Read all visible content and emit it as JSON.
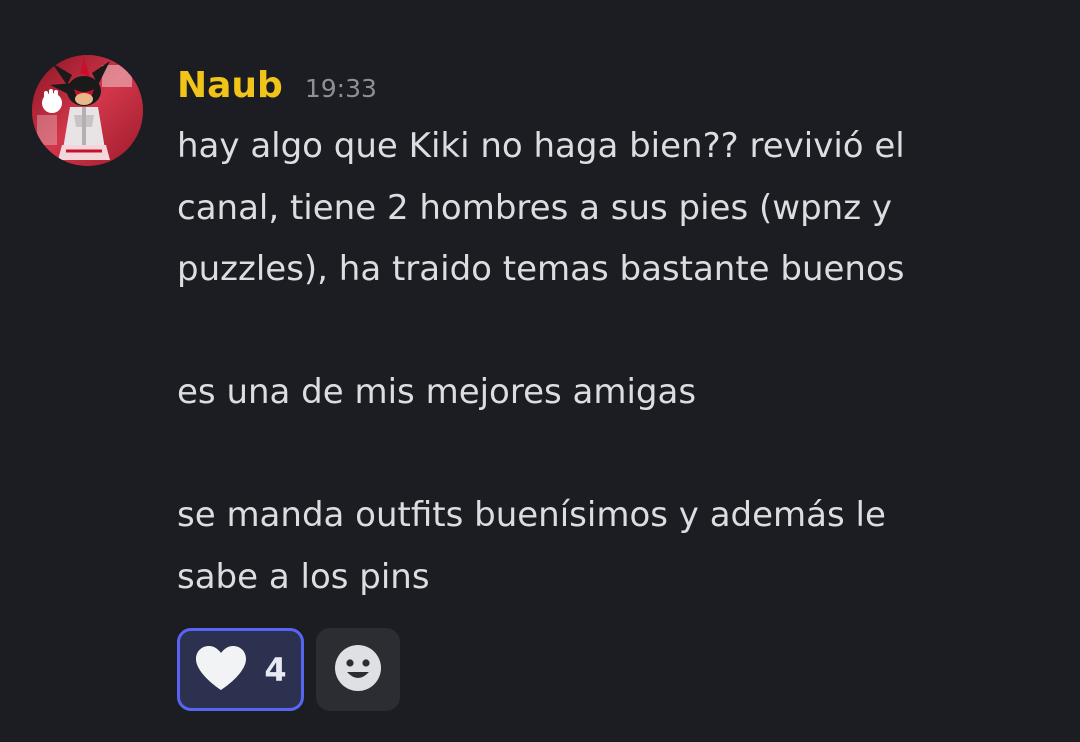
{
  "message": {
    "author": "Naub",
    "timestamp": "19:33",
    "author_color": "#f0c419",
    "paragraphs": [
      [
        "hay algo que Kiki no haga bien?? revivió el",
        "canal, tiene 2 hombres a sus pies (wpnz y",
        "puzzles), ha traido temas bastante buenos"
      ],
      [
        "es una de mis mejores amigas"
      ],
      [
        "se manda outfits buenísimos y además le",
        "sabe a los pins"
      ]
    ]
  },
  "reactions": [
    {
      "icon": "heart-icon",
      "count": "4",
      "active": true
    }
  ],
  "add_reaction": {
    "icon": "smiley-icon"
  },
  "colors": {
    "background": "#1c1d22",
    "reaction_active_bg": "#2d3150",
    "reaction_active_border": "#5865f2"
  }
}
